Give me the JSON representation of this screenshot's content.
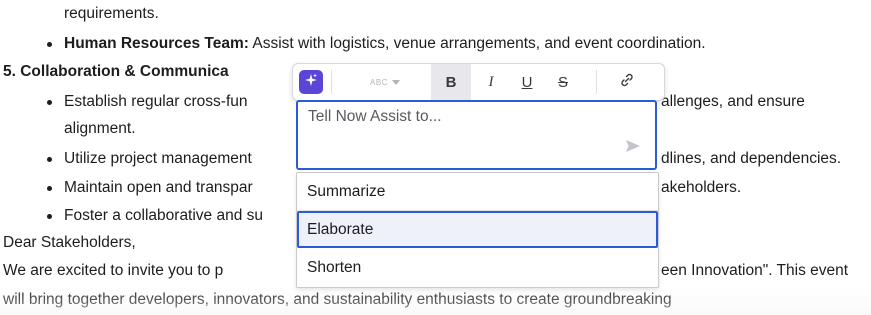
{
  "document": {
    "line_requirements": "requirements.",
    "hr_bold": "Human Resources Team:",
    "hr_rest": " Assist with logistics, venue arrangements, and event coordination.",
    "section_heading": "5. Collaboration & Communica",
    "bullet1_left": "Establish regular cross-fun",
    "bullet1_right": "allenges, and ensure",
    "bullet1_cont": "alignment.",
    "bullet2_left": "Utilize project management",
    "bullet2_right": "dlines, and dependencies.",
    "bullet3_left": "Maintain open and transpar",
    "bullet3_right": "akeholders.",
    "bullet4_left": "Foster a collaborative and su",
    "dear": "Dear Stakeholders,",
    "para1_left": "We are excited to invite you to p",
    "para1_right": "een Innovation\". This event",
    "para2": "will bring together developers, innovators, and sustainability enthusiasts to create groundbreaking"
  },
  "toolbar": {
    "format_label": "ABC",
    "bold_label": "B",
    "italic_label": "I",
    "underline_label": "U",
    "strike_label": "S",
    "icons": [
      "sparkle-icon",
      "chevron-down-icon",
      "link-icon"
    ],
    "accent_color": "#5a46d6"
  },
  "assist": {
    "placeholder": "Tell Now Assist to...",
    "send_icon": "send-icon",
    "focus_color": "#2d5bd8"
  },
  "menu": {
    "items": [
      {
        "label": "Summarize"
      },
      {
        "label": "Elaborate"
      },
      {
        "label": "Shorten"
      }
    ],
    "active_index": 1
  }
}
